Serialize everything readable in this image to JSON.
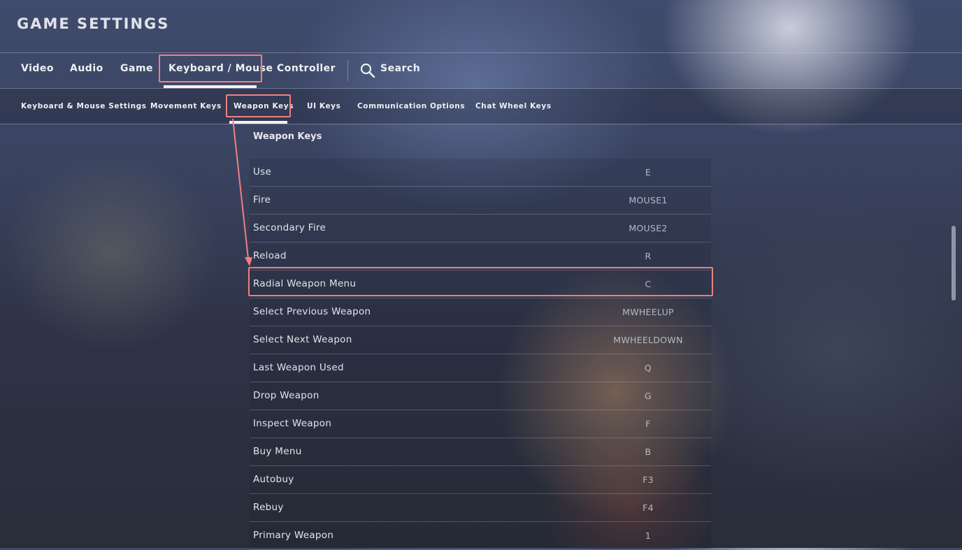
{
  "header": {
    "title": "GAME SETTINGS"
  },
  "tabs": [
    {
      "label": "Video"
    },
    {
      "label": "Audio"
    },
    {
      "label": "Game"
    },
    {
      "label": "Keyboard / Mouse"
    },
    {
      "label": "Controller"
    }
  ],
  "search": {
    "label": "Search"
  },
  "subtabs": [
    {
      "label": "Keyboard & Mouse Settings"
    },
    {
      "label": "Movement Keys"
    },
    {
      "label": "Weapon Keys"
    },
    {
      "label": "UI Keys"
    },
    {
      "label": "Communication Options"
    },
    {
      "label": "Chat Wheel Keys"
    }
  ],
  "section": {
    "title": "Weapon Keys"
  },
  "bindings": [
    {
      "action": "Use",
      "key": "E"
    },
    {
      "action": "Fire",
      "key": "MOUSE1"
    },
    {
      "action": "Secondary Fire",
      "key": "MOUSE2"
    },
    {
      "action": "Reload",
      "key": "R"
    },
    {
      "action": "Radial Weapon Menu",
      "key": "C"
    },
    {
      "action": "Select Previous Weapon",
      "key": "MWHEELUP"
    },
    {
      "action": "Select Next Weapon",
      "key": "MWHEELDOWN"
    },
    {
      "action": "Last Weapon Used",
      "key": "Q"
    },
    {
      "action": "Drop Weapon",
      "key": "G"
    },
    {
      "action": "Inspect Weapon",
      "key": "F"
    },
    {
      "action": "Buy Menu",
      "key": "B"
    },
    {
      "action": "Autobuy",
      "key": "F3"
    },
    {
      "action": "Rebuy",
      "key": "F4"
    },
    {
      "action": "Primary Weapon",
      "key": "1"
    }
  ],
  "colors": {
    "highlight": "#f07f7f",
    "underline": "#f2f2f2"
  }
}
